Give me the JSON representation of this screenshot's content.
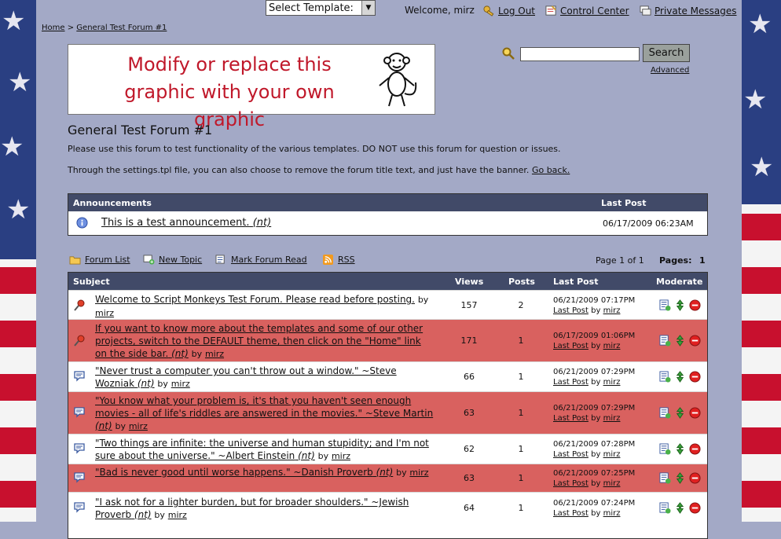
{
  "topbar": {
    "template_select": "Select Template:",
    "welcome": "Welcome, mirz",
    "logout": "Log Out",
    "control_center": "Control Center",
    "private_messages": "Private Messages"
  },
  "breadcrumb": {
    "home": "Home",
    "separator": ">",
    "current": "General Test Forum #1"
  },
  "banner": {
    "line1": "Modify or replace this",
    "line2": "graphic with your own graphic"
  },
  "search": {
    "button": "Search",
    "advanced": "Advanced",
    "value": ""
  },
  "forum": {
    "title": "General Test Forum #1",
    "description": "Please use this forum to test functionality of the various templates. DO NOT use this forum for question or issues.",
    "description2": "Through the settings.tpl file, you can also choose to remove the forum title text, and just have the banner.",
    "go_back": "Go back."
  },
  "announcements": {
    "header": "Announcements",
    "last_post_header": "Last Post",
    "items": [
      {
        "title": "This is a test announcement.",
        "tag": "(nt)",
        "last_post": "06/17/2009 06:23AM"
      }
    ]
  },
  "actions": {
    "forum_list": "Forum List",
    "new_topic": "New Topic",
    "mark_read": "Mark Forum Read",
    "rss": "RSS",
    "page_info": "Page 1 of 1",
    "pages_label": "Pages:",
    "pages_value": "1"
  },
  "threads": {
    "headers": {
      "subject": "Subject",
      "views": "Views",
      "posts": "Posts",
      "last_post": "Last Post",
      "moderate": "Moderate"
    },
    "by_label": "by",
    "last_post_link": "Last Post",
    "rows": [
      {
        "title": "Welcome to Script Monkeys Test Forum. Please read before posting.",
        "nt": "",
        "author": "mirz",
        "views": "157",
        "posts": "2",
        "date": "06/21/2009 07:17PM",
        "last_by": "mirz",
        "sticky": true
      },
      {
        "title": "If you want to know more about the templates and some of our other projects, switch to the DEFAULT theme, then click on the \"Home\" link on the side bar.",
        "nt": "(nt)",
        "author": "mirz",
        "views": "171",
        "posts": "1",
        "date": "06/17/2009 01:06PM",
        "last_by": "mirz",
        "sticky": true
      },
      {
        "title": "\"Never trust a computer you can't throw out a window.\" ~Steve Wozniak",
        "nt": "(nt)",
        "author": "mirz",
        "views": "66",
        "posts": "1",
        "date": "06/21/2009 07:29PM",
        "last_by": "mirz",
        "sticky": false
      },
      {
        "title": "\"You know what your problem is, it's that you haven't seen enough movies - all of life's riddles are answered in the movies.\" ~Steve Martin",
        "nt": "(nt)",
        "author": "mirz",
        "views": "63",
        "posts": "1",
        "date": "06/21/2009 07:29PM",
        "last_by": "mirz",
        "sticky": false
      },
      {
        "title": "\"Two things are infinite: the universe and human stupidity; and I'm not sure about the universe.\" ~Albert Einstein",
        "nt": "(nt)",
        "author": "mirz",
        "views": "62",
        "posts": "1",
        "date": "06/21/2009 07:28PM",
        "last_by": "mirz",
        "sticky": false
      },
      {
        "title": "\"Bad is never good until worse happens.\" ~Danish Proverb",
        "nt": "(nt)",
        "author": "mirz",
        "views": "63",
        "posts": "1",
        "date": "06/21/2009 07:25PM",
        "last_by": "mirz",
        "sticky": false
      },
      {
        "title": "\"I ask not for a lighter burden, but for broader shoulders.\" ~Jewish Proverb",
        "nt": "(nt)",
        "author": "mirz",
        "views": "64",
        "posts": "1",
        "date": "06/21/2009 07:24PM",
        "last_by": "mirz",
        "sticky": false
      }
    ]
  },
  "colors": {
    "header_bg": "#414a68",
    "page_bg": "#a3a9c6",
    "alt_row": "#d9615f",
    "banner_text": "#c0182a"
  }
}
